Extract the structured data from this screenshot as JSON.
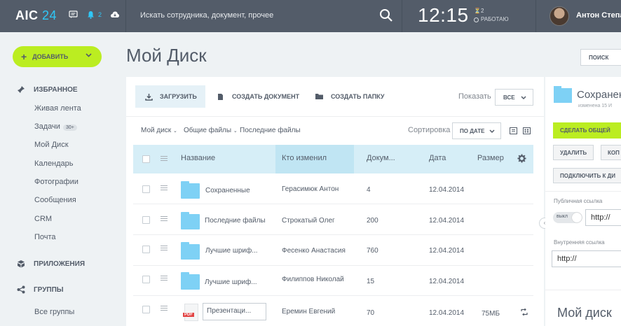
{
  "header": {
    "logo_main": "AIC",
    "logo_num": "24",
    "notification_count": "2",
    "search_placeholder": "Искать сотрудника, документ, прочее",
    "time": "12:15",
    "work_count": "2",
    "work_status": "РАБОТАЮ",
    "user_name": "Антон Степа"
  },
  "sidebar": {
    "add_button": "ДОБАВИТЬ",
    "favorites": "ИЗБРАННОЕ",
    "items": [
      {
        "label": "Живая лента"
      },
      {
        "label": "Задачи",
        "badge": "30+"
      },
      {
        "label": "Мой Диск"
      },
      {
        "label": "Календарь"
      },
      {
        "label": "Фотографии"
      },
      {
        "label": "Сообщения"
      },
      {
        "label": "CRM"
      },
      {
        "label": "Почта"
      }
    ],
    "apps": "ПРИЛОЖЕНИЯ",
    "groups": "ГРУППЫ",
    "all_groups": "Все группы"
  },
  "page": {
    "title": "Мой Диск",
    "search_button": "ПОИСК"
  },
  "toolbar": {
    "upload": "ЗАГРУЗИТЬ",
    "create_doc": "СОЗДАТЬ ДОКУМЕНТ",
    "create_folder": "СОЗДАТЬ ПАПКУ",
    "show_label": "Показать",
    "show_value": "ВСЕ"
  },
  "filters": {
    "breadcrumbs": [
      "Мой диск",
      "Общие файлы",
      "Последние файлы"
    ],
    "sort_label": "Сортировка",
    "sort_value": "ПО ДАТЕ"
  },
  "table": {
    "columns": [
      "Название",
      "Кто изменил",
      "Докум...",
      "Дата",
      "Размер"
    ],
    "rows": [
      {
        "name": "Сохраненные",
        "modified_by": "Герасимюк Антон",
        "docs": "4",
        "date": "12.04.2014",
        "size": "",
        "type": "folder"
      },
      {
        "name": "Последние файлы",
        "modified_by": "Строкатый Олег",
        "docs": "200",
        "date": "12.04.2014",
        "size": "",
        "type": "folder"
      },
      {
        "name": "Лучшие шриф...",
        "modified_by": "Фесенко Анастасия",
        "docs": "760",
        "date": "12.04.2014",
        "size": "",
        "type": "folder"
      },
      {
        "name": "Лучшие шриф...",
        "modified_by": "Филиппов Николай",
        "docs": "15",
        "date": "12.04.2014",
        "size": "",
        "type": "folder"
      },
      {
        "name": "Презентаци...",
        "modified_by": "Еремин Евгений",
        "docs": "70",
        "date": "12.04.2014",
        "size": "75МБ",
        "type": "pdf"
      }
    ]
  },
  "details": {
    "title": "Сохранен",
    "subtitle": "изменена 15 И",
    "share_button": "СДЕЛАТЬ ОБЩЕЙ",
    "delete_button": "УДАЛИТЬ",
    "copy_button": "КОП",
    "connect_button": "ПОДКЛЮЧИТЬ К ДИ",
    "public_link_label": "Публичная ссылка",
    "toggle_label": "выкл",
    "public_link_value": "http://",
    "internal_link_label": "Внутренняя ссылка",
    "internal_link_value": "http://",
    "bottom_title": "Мой диск"
  },
  "pdf_label": "PDF",
  "colors": {
    "accent_green": "#bbed21",
    "accent_blue": "#2fc7f7",
    "header_bg": "#535c69",
    "folder": "#7ed1f5"
  }
}
